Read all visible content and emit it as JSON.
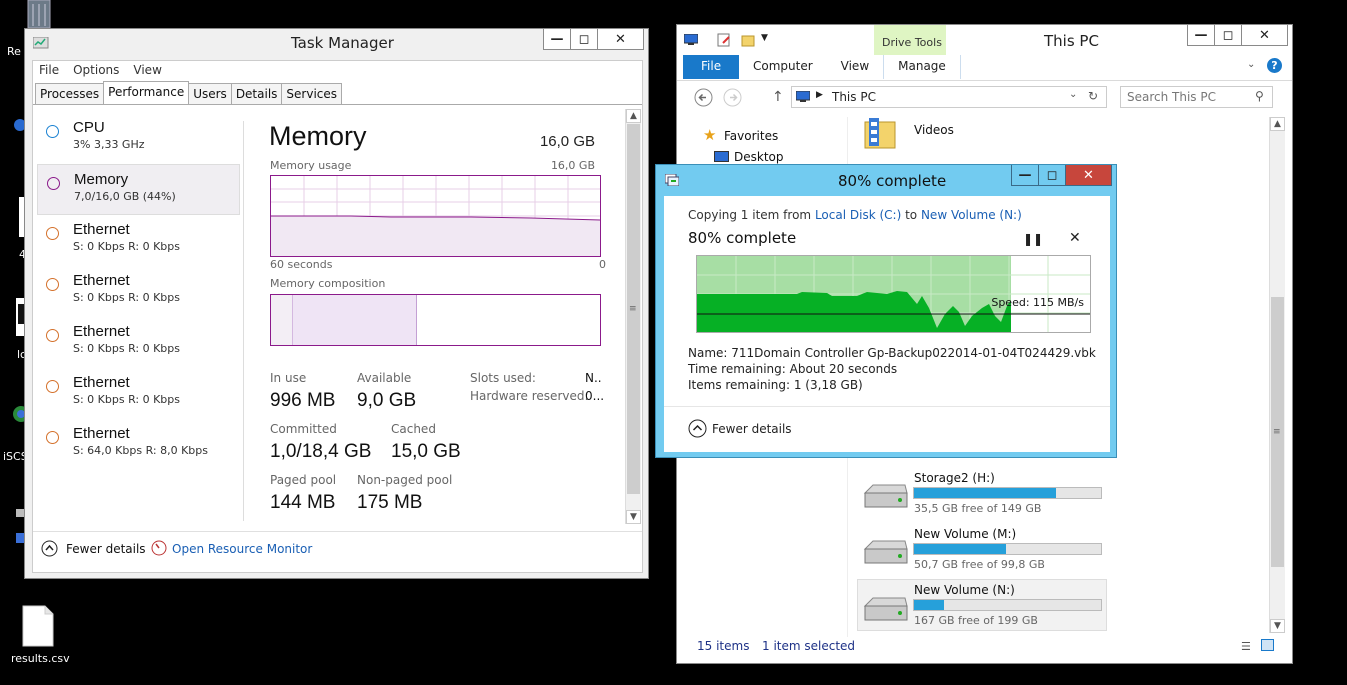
{
  "desktop": {
    "icons": [
      {
        "label": "Re",
        "icon": "recycle-bin-icon"
      },
      {
        "label": "4",
        "icon": "document-icon"
      },
      {
        "label": "lc",
        "icon": "app-icon"
      },
      {
        "label": "iSCS",
        "icon": "globe-icon"
      },
      {
        "label": "results.csv",
        "icon": "file-icon"
      }
    ]
  },
  "task_manager": {
    "title": "Task Manager",
    "menu": [
      "File",
      "Options",
      "View"
    ],
    "tabs": [
      "Processes",
      "Performance",
      "Users",
      "Details",
      "Services"
    ],
    "active_tab": "Performance",
    "perf_items": [
      {
        "name": "CPU",
        "sub": "3% 3,33 GHz",
        "color": "#1b82d2"
      },
      {
        "name": "Memory",
        "sub": "7,0/16,0 GB (44%)",
        "color": "#8b1a8b"
      },
      {
        "name": "Ethernet",
        "sub": "S: 0 Kbps R: 0 Kbps",
        "color": "#d4712b"
      },
      {
        "name": "Ethernet",
        "sub": "S: 0 Kbps R: 0 Kbps",
        "color": "#d4712b"
      },
      {
        "name": "Ethernet",
        "sub": "S: 0 Kbps R: 0 Kbps",
        "color": "#d4712b"
      },
      {
        "name": "Ethernet",
        "sub": "S: 0 Kbps R: 0 Kbps",
        "color": "#d4712b"
      },
      {
        "name": "Ethernet",
        "sub": "S: 64,0 Kbps R: 8,0 Kbps",
        "color": "#d4712b"
      }
    ],
    "memory": {
      "title": "Memory",
      "total": "16,0 GB",
      "usage_label": "Memory usage",
      "usage_max": "16,0 GB",
      "time_left": "60 seconds",
      "time_right": "0",
      "composition_label": "Memory composition",
      "in_use_label": "In use",
      "in_use": "996 MB",
      "available_label": "Available",
      "available": "9,0 GB",
      "slots_label": "Slots used:",
      "slots": "N..",
      "hw_reserved_label": "Hardware reserved:",
      "hw_reserved": "0...",
      "committed_label": "Committed",
      "committed": "1,0/18,4 GB",
      "cached_label": "Cached",
      "cached": "15,0 GB",
      "paged_label": "Paged pool",
      "paged": "144 MB",
      "nonpaged_label": "Non-paged pool",
      "nonpaged": "175 MB"
    },
    "footer": {
      "fewer_details": "Fewer details",
      "resource_monitor": "Open Resource Monitor"
    }
  },
  "explorer": {
    "title": "This PC",
    "context_tab": "Drive Tools",
    "ribbon_tabs": [
      "File",
      "Computer",
      "View",
      "Manage"
    ],
    "address": "This PC",
    "search_placeholder": "Search This PC",
    "nav": [
      "Favorites",
      "Desktop"
    ],
    "folders": [
      {
        "name": "Videos"
      }
    ],
    "drives": [
      {
        "name": "Storage2 (H:)",
        "free": "35,5 GB free of 149 GB",
        "used_fraction": 0.76
      },
      {
        "name": "New Volume (M:)",
        "free": "50,7 GB free of 99,8 GB",
        "used_fraction": 0.49
      },
      {
        "name": "New Volume (N:)",
        "free": "167 GB free of 199 GB",
        "used_fraction": 0.16
      }
    ],
    "status": {
      "items": "15 items",
      "selected": "1 item selected"
    }
  },
  "copy_dialog": {
    "title": "80% complete",
    "copying_prefix": "Copying 1 item from",
    "from": "Local Disk (C:)",
    "to_word": "to",
    "to": "New Volume (N:)",
    "progress_text": "80% complete",
    "progress": 0.8,
    "speed": "Speed: 115 MB/s",
    "name_label": "Name:",
    "name": "711Domain Controller Gp-Backup022014-01-04T024429.vbk",
    "time_label": "Time remaining:",
    "time": "About 20 seconds",
    "items_label": "Items remaining:",
    "items": "1 (3,18 GB)",
    "fewer_details": "Fewer details"
  }
}
